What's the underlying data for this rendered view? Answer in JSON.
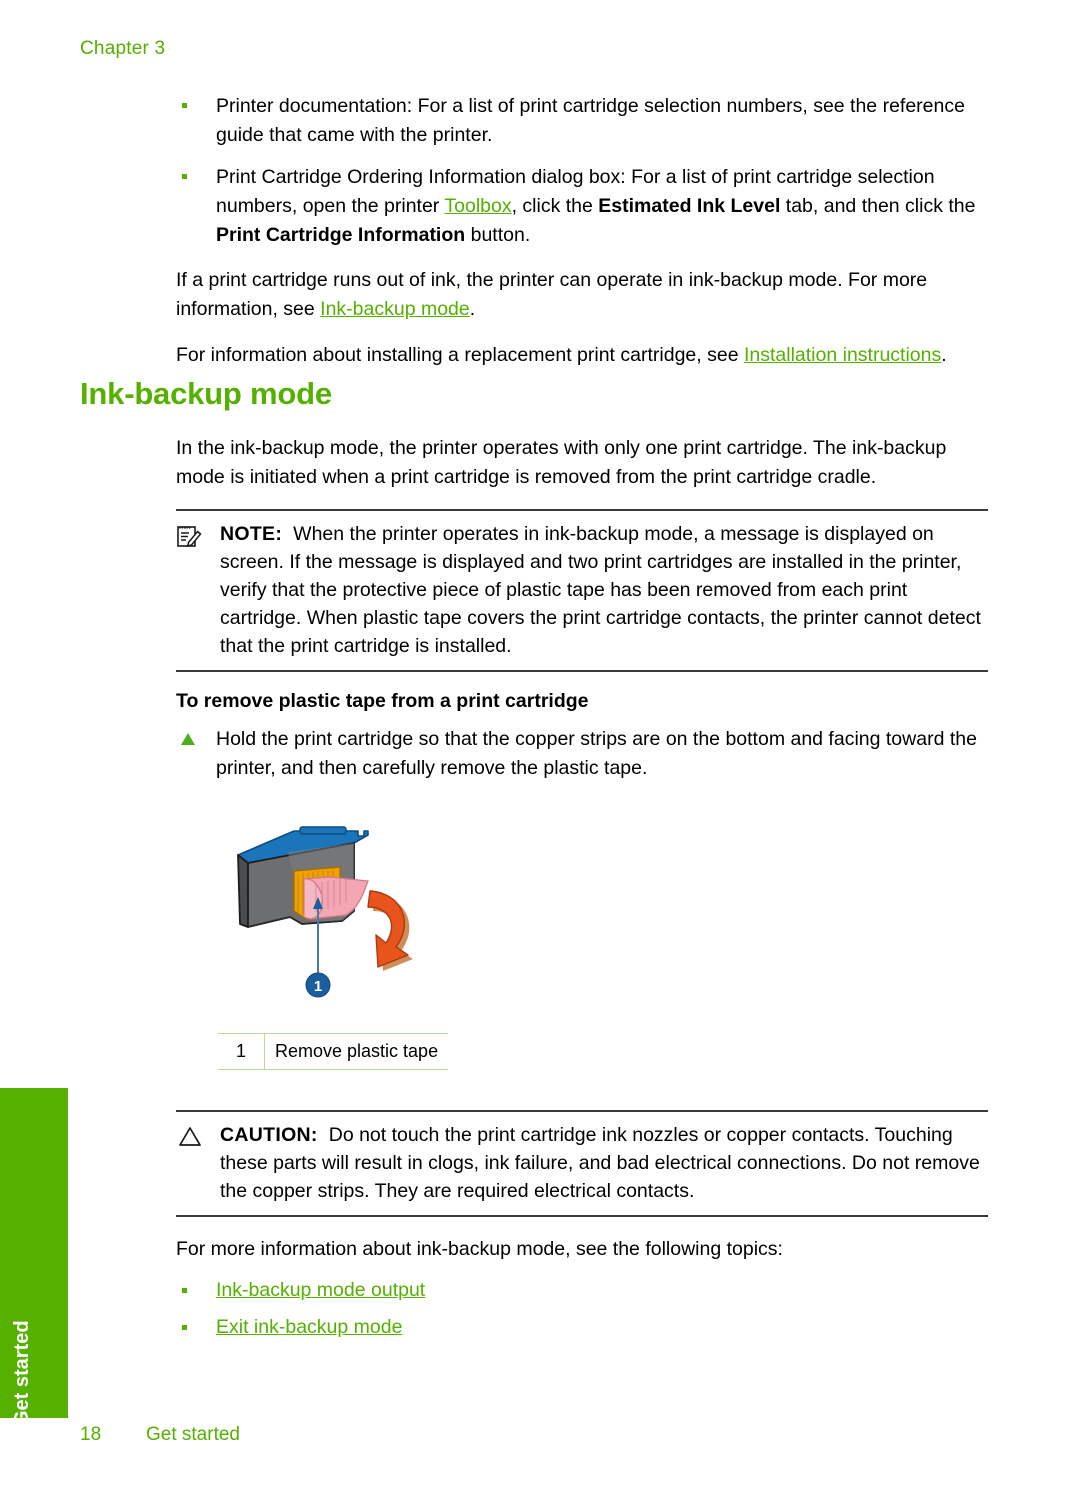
{
  "brand": {
    "green": "#55b000",
    "rule": "#3a3a3a",
    "legend_border": "#b7d99a"
  },
  "header": {
    "chapter": "Chapter 3"
  },
  "intro_bullets": [
    {
      "segments": [
        {
          "t": "Printer documentation: For a list of print cartridge selection numbers, see the reference guide that came with the printer.",
          "s": "plain"
        }
      ]
    },
    {
      "segments": [
        {
          "t": "Print Cartridge Ordering Information dialog box: For a list of print cartridge selection numbers, open the printer ",
          "s": "plain"
        },
        {
          "t": "Toolbox",
          "s": "link"
        },
        {
          "t": ", click the ",
          "s": "plain"
        },
        {
          "t": "Estimated Ink Level",
          "s": "bold"
        },
        {
          "t": " tab, and then click the ",
          "s": "plain"
        },
        {
          "t": "Print Cartridge Information",
          "s": "bold"
        },
        {
          "t": " button.",
          "s": "plain"
        }
      ]
    }
  ],
  "intro_paras": [
    {
      "segments": [
        {
          "t": "If a print cartridge runs out of ink, the printer can operate in ink-backup mode. For more information, see ",
          "s": "plain"
        },
        {
          "t": "Ink-backup mode",
          "s": "link"
        },
        {
          "t": ".",
          "s": "plain"
        }
      ]
    },
    {
      "segments": [
        {
          "t": "For information about installing a replacement print cartridge, see ",
          "s": "plain"
        },
        {
          "t": "Installation instructions",
          "s": "link"
        },
        {
          "t": ".",
          "s": "plain"
        }
      ]
    }
  ],
  "section": {
    "heading": "Ink-backup mode",
    "lead": "In the ink-backup mode, the printer operates with only one print cartridge. The ink-backup mode is initiated when a print cartridge is removed from the print cartridge cradle."
  },
  "note": {
    "icon": "note-pencil-icon",
    "keyword": "NOTE:",
    "text": "When the printer operates in ink-backup mode, a message is displayed on screen. If the message is displayed and two print cartridges are installed in the printer, verify that the protective piece of plastic tape has been removed from each print cartridge. When plastic tape covers the print cartridge contacts, the printer cannot detect that the print cartridge is installed."
  },
  "procedure": {
    "title": "To remove plastic tape from a print cartridge",
    "steps": [
      "Hold the print cartridge so that the copper strips are on the bottom and facing toward the printer, and then carefully remove the plastic tape."
    ]
  },
  "figure": {
    "name": "print-cartridge-remove-tape-illustration",
    "callout_number": "1",
    "colors": {
      "body": "#6d6e70",
      "body_dark": "#4b4c4e",
      "top": "#1b75bb",
      "contacts": "#f0a202",
      "tape": "#f2a7b3",
      "arrow": "#e8541c",
      "callout": "#1b5e9e"
    }
  },
  "legend": {
    "rows": [
      {
        "num": "1",
        "label": "Remove plastic tape"
      }
    ]
  },
  "caution": {
    "icon": "warning-triangle-icon",
    "keyword": "CAUTION:",
    "text": "Do not touch the print cartridge ink nozzles or copper contacts. Touching these parts will result in clogs, ink failure, and bad electrical connections. Do not remove the copper strips. They are required electrical contacts."
  },
  "tail": {
    "lead": "For more information about ink-backup mode, see the following topics:",
    "links": [
      "Ink-backup mode output",
      "Exit ink-backup mode"
    ]
  },
  "side_tab": {
    "label": "Get started"
  },
  "footer": {
    "page_number": "18",
    "section_name": "Get started"
  }
}
